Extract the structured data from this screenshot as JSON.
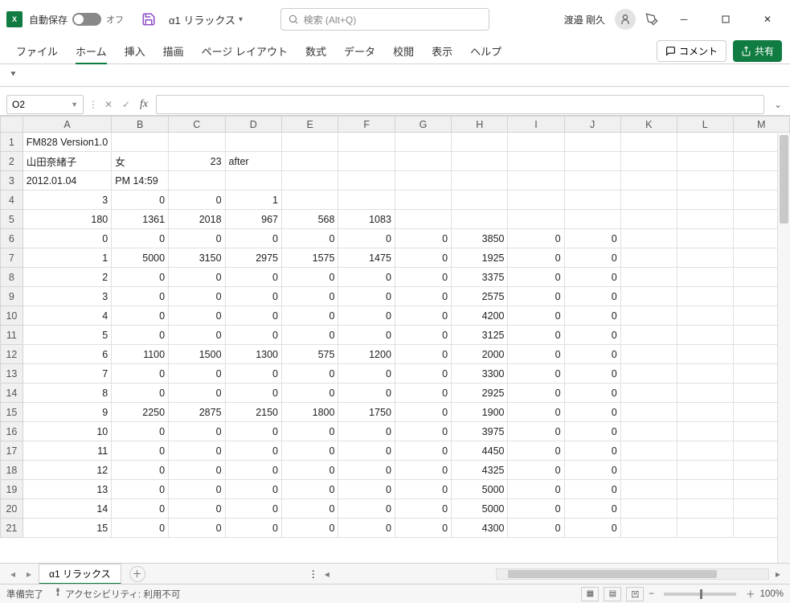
{
  "titlebar": {
    "autosave_label": "自動保存",
    "autosave_state": "オフ",
    "doc_title": "α1 リラックス",
    "search_placeholder": "検索 (Alt+Q)",
    "user_name": "渡邉 剛久"
  },
  "ribbon": {
    "tabs": [
      "ファイル",
      "ホーム",
      "挿入",
      "描画",
      "ページ レイアウト",
      "数式",
      "データ",
      "校閲",
      "表示",
      "ヘルプ"
    ],
    "active_tab_index": 1,
    "comment_label": "コメント",
    "share_label": "共有"
  },
  "namebox": {
    "ref": "O2"
  },
  "formula": {
    "value": ""
  },
  "columns": [
    "A",
    "B",
    "C",
    "D",
    "E",
    "F",
    "G",
    "H",
    "I",
    "J",
    "K",
    "L",
    "M"
  ],
  "rows": [
    {
      "n": 1,
      "cells": {
        "A": {
          "v": "FM828 Version1.0",
          "t": "text"
        }
      }
    },
    {
      "n": 2,
      "cells": {
        "A": {
          "v": "山田奈緒子",
          "t": "text"
        },
        "B": {
          "v": "女",
          "t": "text"
        },
        "C": {
          "v": "23"
        },
        "D": {
          "v": "after",
          "t": "text"
        }
      }
    },
    {
      "n": 3,
      "cells": {
        "A": {
          "v": "2012.01.04",
          "t": "text"
        },
        "B": {
          "v": "PM 14:59",
          "t": "text"
        }
      }
    },
    {
      "n": 4,
      "cells": {
        "A": {
          "v": "3"
        },
        "B": {
          "v": "0"
        },
        "C": {
          "v": "0"
        },
        "D": {
          "v": "1"
        }
      }
    },
    {
      "n": 5,
      "cells": {
        "A": {
          "v": "180"
        },
        "B": {
          "v": "1361"
        },
        "C": {
          "v": "2018"
        },
        "D": {
          "v": "967"
        },
        "E": {
          "v": "568"
        },
        "F": {
          "v": "1083"
        }
      }
    },
    {
      "n": 6,
      "cells": {
        "A": {
          "v": "0"
        },
        "B": {
          "v": "0"
        },
        "C": {
          "v": "0"
        },
        "D": {
          "v": "0"
        },
        "E": {
          "v": "0"
        },
        "F": {
          "v": "0"
        },
        "G": {
          "v": "0"
        },
        "H": {
          "v": "3850"
        },
        "I": {
          "v": "0"
        },
        "J": {
          "v": "0"
        }
      }
    },
    {
      "n": 7,
      "cells": {
        "A": {
          "v": "1"
        },
        "B": {
          "v": "5000"
        },
        "C": {
          "v": "3150"
        },
        "D": {
          "v": "2975"
        },
        "E": {
          "v": "1575"
        },
        "F": {
          "v": "1475"
        },
        "G": {
          "v": "0"
        },
        "H": {
          "v": "1925"
        },
        "I": {
          "v": "0"
        },
        "J": {
          "v": "0"
        }
      }
    },
    {
      "n": 8,
      "cells": {
        "A": {
          "v": "2"
        },
        "B": {
          "v": "0"
        },
        "C": {
          "v": "0"
        },
        "D": {
          "v": "0"
        },
        "E": {
          "v": "0"
        },
        "F": {
          "v": "0"
        },
        "G": {
          "v": "0"
        },
        "H": {
          "v": "3375"
        },
        "I": {
          "v": "0"
        },
        "J": {
          "v": "0"
        }
      }
    },
    {
      "n": 9,
      "cells": {
        "A": {
          "v": "3"
        },
        "B": {
          "v": "0"
        },
        "C": {
          "v": "0"
        },
        "D": {
          "v": "0"
        },
        "E": {
          "v": "0"
        },
        "F": {
          "v": "0"
        },
        "G": {
          "v": "0"
        },
        "H": {
          "v": "2575"
        },
        "I": {
          "v": "0"
        },
        "J": {
          "v": "0"
        }
      }
    },
    {
      "n": 10,
      "cells": {
        "A": {
          "v": "4"
        },
        "B": {
          "v": "0"
        },
        "C": {
          "v": "0"
        },
        "D": {
          "v": "0"
        },
        "E": {
          "v": "0"
        },
        "F": {
          "v": "0"
        },
        "G": {
          "v": "0"
        },
        "H": {
          "v": "4200"
        },
        "I": {
          "v": "0"
        },
        "J": {
          "v": "0"
        }
      }
    },
    {
      "n": 11,
      "cells": {
        "A": {
          "v": "5"
        },
        "B": {
          "v": "0"
        },
        "C": {
          "v": "0"
        },
        "D": {
          "v": "0"
        },
        "E": {
          "v": "0"
        },
        "F": {
          "v": "0"
        },
        "G": {
          "v": "0"
        },
        "H": {
          "v": "3125"
        },
        "I": {
          "v": "0"
        },
        "J": {
          "v": "0"
        }
      }
    },
    {
      "n": 12,
      "cells": {
        "A": {
          "v": "6"
        },
        "B": {
          "v": "1100"
        },
        "C": {
          "v": "1500"
        },
        "D": {
          "v": "1300"
        },
        "E": {
          "v": "575"
        },
        "F": {
          "v": "1200"
        },
        "G": {
          "v": "0"
        },
        "H": {
          "v": "2000"
        },
        "I": {
          "v": "0"
        },
        "J": {
          "v": "0"
        }
      }
    },
    {
      "n": 13,
      "cells": {
        "A": {
          "v": "7"
        },
        "B": {
          "v": "0"
        },
        "C": {
          "v": "0"
        },
        "D": {
          "v": "0"
        },
        "E": {
          "v": "0"
        },
        "F": {
          "v": "0"
        },
        "G": {
          "v": "0"
        },
        "H": {
          "v": "3300"
        },
        "I": {
          "v": "0"
        },
        "J": {
          "v": "0"
        }
      }
    },
    {
      "n": 14,
      "cells": {
        "A": {
          "v": "8"
        },
        "B": {
          "v": "0"
        },
        "C": {
          "v": "0"
        },
        "D": {
          "v": "0"
        },
        "E": {
          "v": "0"
        },
        "F": {
          "v": "0"
        },
        "G": {
          "v": "0"
        },
        "H": {
          "v": "2925"
        },
        "I": {
          "v": "0"
        },
        "J": {
          "v": "0"
        }
      }
    },
    {
      "n": 15,
      "cells": {
        "A": {
          "v": "9"
        },
        "B": {
          "v": "2250"
        },
        "C": {
          "v": "2875"
        },
        "D": {
          "v": "2150"
        },
        "E": {
          "v": "1800"
        },
        "F": {
          "v": "1750"
        },
        "G": {
          "v": "0"
        },
        "H": {
          "v": "1900"
        },
        "I": {
          "v": "0"
        },
        "J": {
          "v": "0"
        }
      }
    },
    {
      "n": 16,
      "cells": {
        "A": {
          "v": "10"
        },
        "B": {
          "v": "0"
        },
        "C": {
          "v": "0"
        },
        "D": {
          "v": "0"
        },
        "E": {
          "v": "0"
        },
        "F": {
          "v": "0"
        },
        "G": {
          "v": "0"
        },
        "H": {
          "v": "3975"
        },
        "I": {
          "v": "0"
        },
        "J": {
          "v": "0"
        }
      }
    },
    {
      "n": 17,
      "cells": {
        "A": {
          "v": "11"
        },
        "B": {
          "v": "0"
        },
        "C": {
          "v": "0"
        },
        "D": {
          "v": "0"
        },
        "E": {
          "v": "0"
        },
        "F": {
          "v": "0"
        },
        "G": {
          "v": "0"
        },
        "H": {
          "v": "4450"
        },
        "I": {
          "v": "0"
        },
        "J": {
          "v": "0"
        }
      }
    },
    {
      "n": 18,
      "cells": {
        "A": {
          "v": "12"
        },
        "B": {
          "v": "0"
        },
        "C": {
          "v": "0"
        },
        "D": {
          "v": "0"
        },
        "E": {
          "v": "0"
        },
        "F": {
          "v": "0"
        },
        "G": {
          "v": "0"
        },
        "H": {
          "v": "4325"
        },
        "I": {
          "v": "0"
        },
        "J": {
          "v": "0"
        }
      }
    },
    {
      "n": 19,
      "cells": {
        "A": {
          "v": "13"
        },
        "B": {
          "v": "0"
        },
        "C": {
          "v": "0"
        },
        "D": {
          "v": "0"
        },
        "E": {
          "v": "0"
        },
        "F": {
          "v": "0"
        },
        "G": {
          "v": "0"
        },
        "H": {
          "v": "5000"
        },
        "I": {
          "v": "0"
        },
        "J": {
          "v": "0"
        }
      }
    },
    {
      "n": 20,
      "cells": {
        "A": {
          "v": "14"
        },
        "B": {
          "v": "0"
        },
        "C": {
          "v": "0"
        },
        "D": {
          "v": "0"
        },
        "E": {
          "v": "0"
        },
        "F": {
          "v": "0"
        },
        "G": {
          "v": "0"
        },
        "H": {
          "v": "5000"
        },
        "I": {
          "v": "0"
        },
        "J": {
          "v": "0"
        }
      }
    },
    {
      "n": 21,
      "cells": {
        "A": {
          "v": "15"
        },
        "B": {
          "v": "0"
        },
        "C": {
          "v": "0"
        },
        "D": {
          "v": "0"
        },
        "E": {
          "v": "0"
        },
        "F": {
          "v": "0"
        },
        "G": {
          "v": "0"
        },
        "H": {
          "v": "4300"
        },
        "I": {
          "v": "0"
        },
        "J": {
          "v": "0"
        }
      }
    }
  ],
  "sheets": {
    "tabs": [
      "α1 リラックス"
    ],
    "active": 0
  },
  "status": {
    "ready": "準備完了",
    "accessibility": "アクセシビリティ: 利用不可",
    "zoom": "100%"
  }
}
